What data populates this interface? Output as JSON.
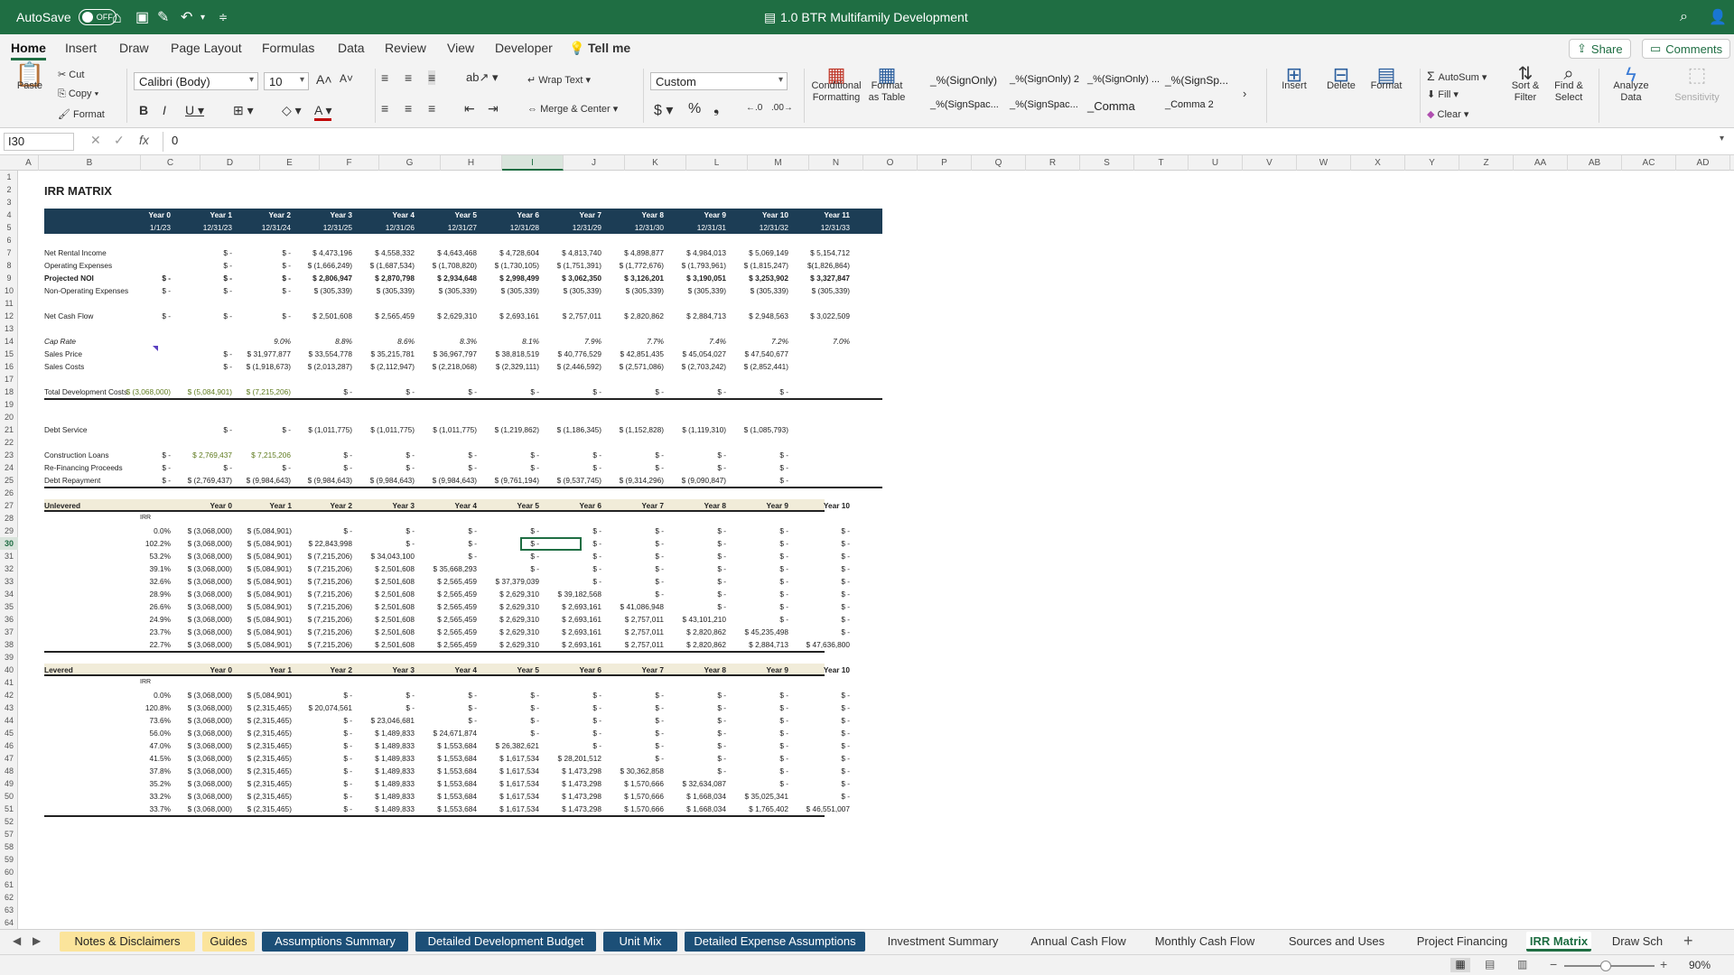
{
  "titlebar": {
    "autosave": "AutoSave",
    "toggle": "OFF",
    "doc_title": "1.0 BTR Multifamily Development"
  },
  "ribbon_tabs": [
    "Home",
    "Insert",
    "Draw",
    "Page Layout",
    "Formulas",
    "Data",
    "Review",
    "View",
    "Developer",
    "Tell me"
  ],
  "share": "Share",
  "comments": "Comments",
  "ribbon": {
    "paste": "Paste",
    "cut": "Cut",
    "copy": "Copy",
    "format": "Format",
    "font": "Calibri (Body)",
    "size": "10",
    "wrap": "Wrap Text",
    "merge": "Merge & Center",
    "number_format": "Custom",
    "cond": "Conditional Formatting",
    "fmt_table": "Format as Table",
    "styles": [
      "_%(SignOnly)",
      "_%(SignOnly) 2",
      "_%(SignOnly) ...",
      "_%(SignSp...",
      "_%(SignSpac...",
      "_%(SignSpac...",
      "_Comma",
      "_Comma 2"
    ],
    "insert": "Insert",
    "delete": "Delete",
    "format_cells": "Format",
    "autosum": "AutoSum",
    "fill": "Fill",
    "clear": "Clear",
    "sort": "Sort & Filter",
    "find": "Find & Select",
    "analyze": "Analyze Data",
    "sensitivity": "Sensitivity"
  },
  "formula_bar": {
    "cell": "I30",
    "fx": "fx",
    "value": "0"
  },
  "columns": [
    "A",
    "B",
    "C",
    "D",
    "E",
    "F",
    "G",
    "H",
    "I",
    "J",
    "K",
    "L",
    "M",
    "N",
    "O",
    "P",
    "Q",
    "R",
    "S",
    "T",
    "U",
    "V",
    "W",
    "X",
    "Y",
    "Z",
    "AA",
    "AB",
    "AC",
    "AD"
  ],
  "title": "IRR MATRIX",
  "years": [
    "Year 0",
    "Year 1",
    "Year 2",
    "Year 3",
    "Year 4",
    "Year 5",
    "Year 6",
    "Year 7",
    "Year 8",
    "Year 9",
    "Year 10",
    "Year 11"
  ],
  "dates": [
    "1/1/23",
    "12/31/23",
    "12/31/24",
    "12/31/25",
    "12/31/26",
    "12/31/27",
    "12/31/28",
    "12/31/29",
    "12/31/30",
    "12/31/31",
    "12/31/32",
    "12/31/33"
  ],
  "rows": {
    "nri": {
      "label": "Net Rental Income",
      "v": [
        "",
        "$ -",
        "$ -",
        "$ 4,473,196",
        "$ 4,558,332",
        "$ 4,643,468",
        "$ 4,728,604",
        "$ 4,813,740",
        "$ 4,898,877",
        "$ 4,984,013",
        "$ 5,069,149",
        "$ 5,154,712"
      ]
    },
    "opex": {
      "label": "Operating Expenses",
      "v": [
        "",
        "$ -",
        "$ -",
        "$ (1,666,249)",
        "$ (1,687,534)",
        "$ (1,708,820)",
        "$ (1,730,105)",
        "$ (1,751,391)",
        "$ (1,772,676)",
        "$ (1,793,961)",
        "$ (1,815,247)",
        "$(1,826,864)"
      ]
    },
    "noi": {
      "label": "Projected NOI",
      "v": [
        "$ -",
        "$ -",
        "$ -",
        "$ 2,806,947",
        "$ 2,870,798",
        "$ 2,934,648",
        "$ 2,998,499",
        "$ 3,062,350",
        "$ 3,126,201",
        "$ 3,190,051",
        "$ 3,253,902",
        "$ 3,327,847"
      ]
    },
    "nonop": {
      "label": "Non-Operating Expenses",
      "v": [
        "$ -",
        "$ -",
        "$ -",
        "$ (305,339)",
        "$ (305,339)",
        "$ (305,339)",
        "$ (305,339)",
        "$ (305,339)",
        "$ (305,339)",
        "$ (305,339)",
        "$ (305,339)",
        "$ (305,339)"
      ]
    },
    "ncf": {
      "label": "Net Cash Flow",
      "v": [
        "$ -",
        "$ -",
        "$ -",
        "$ 2,501,608",
        "$ 2,565,459",
        "$ 2,629,310",
        "$ 2,693,161",
        "$ 2,757,011",
        "$ 2,820,862",
        "$ 2,884,713",
        "$ 2,948,563",
        "$ 3,022,509"
      ]
    },
    "cap": {
      "label": "Cap Rate",
      "v": [
        "",
        "",
        "9.0%",
        "8.8%",
        "8.6%",
        "8.3%",
        "8.1%",
        "7.9%",
        "7.7%",
        "7.4%",
        "7.2%",
        "7.0%"
      ]
    },
    "sp": {
      "label": "Sales Price",
      "v": [
        "",
        "$ -",
        "$ 31,977,877",
        "$ 33,554,778",
        "$ 35,215,781",
        "$ 36,967,797",
        "$ 38,818,519",
        "$ 40,776,529",
        "$ 42,851,435",
        "$ 45,054,027",
        "$ 47,540,677",
        ""
      ]
    },
    "sc": {
      "label": "Sales Costs",
      "v": [
        "",
        "$ -",
        "$ (1,918,673)",
        "$ (2,013,287)",
        "$ (2,112,947)",
        "$ (2,218,068)",
        "$ (2,329,111)",
        "$ (2,446,592)",
        "$ (2,571,086)",
        "$ (2,703,242)",
        "$ (2,852,441)",
        ""
      ]
    },
    "tdc": {
      "label": "Total Development Costs",
      "v": [
        "$ (3,068,000)",
        "$ (5,084,901)",
        "$ (7,215,206)",
        "$ -",
        "$ -",
        "$ -",
        "$ -",
        "$ -",
        "$ -",
        "$ -",
        "$ -",
        ""
      ]
    },
    "ds": {
      "label": "Debt Service",
      "v": [
        "",
        "$ -",
        "$ -",
        "$ (1,011,775)",
        "$ (1,011,775)",
        "$ (1,011,775)",
        "$ (1,219,862)",
        "$ (1,186,345)",
        "$ (1,152,828)",
        "$ (1,119,310)",
        "$ (1,085,793)",
        ""
      ]
    },
    "cl": {
      "label": "Construction Loans",
      "v": [
        "$ -",
        "$ 2,769,437",
        "$ 7,215,206",
        "$ -",
        "$ -",
        "$ -",
        "$ -",
        "$ -",
        "$ -",
        "$ -",
        "$ -",
        ""
      ]
    },
    "rf": {
      "label": "Re-Financing Proceeds",
      "v": [
        "$ -",
        "$ -",
        "$ -",
        "$ -",
        "$ -",
        "$ -",
        "$ -",
        "$ -",
        "$ -",
        "$ -",
        "$ -",
        ""
      ]
    },
    "dr": {
      "label": "Debt Repayment",
      "v": [
        "$ -",
        "$ (2,769,437)",
        "$ (9,984,643)",
        "$ (9,984,643)",
        "$ (9,984,643)",
        "$ (9,984,643)",
        "$ (9,761,194)",
        "$ (9,537,745)",
        "$ (9,314,296)",
        "$ (9,090,847)",
        "$ -",
        ""
      ]
    }
  },
  "unlevered": {
    "label": "Unlevered",
    "irr": "IRR",
    "rows": [
      [
        "0.0%",
        "$ (3,068,000)",
        "$ (5,084,901)",
        "$ -",
        "$ -",
        "$ -",
        "$ -",
        "$ -",
        "$ -",
        "$ -",
        "$ -",
        "$ -"
      ],
      [
        "102.2%",
        "$ (3,068,000)",
        "$ (5,084,901)",
        "$ 22,843,998",
        "$ -",
        "$ -",
        "$ -",
        "$ -",
        "$ -",
        "$ -",
        "$ -",
        "$ -"
      ],
      [
        "53.2%",
        "$ (3,068,000)",
        "$ (5,084,901)",
        "$ (7,215,206)",
        "$ 34,043,100",
        "$ -",
        "$ -",
        "$ -",
        "$ -",
        "$ -",
        "$ -",
        "$ -"
      ],
      [
        "39.1%",
        "$ (3,068,000)",
        "$ (5,084,901)",
        "$ (7,215,206)",
        "$ 2,501,608",
        "$ 35,668,293",
        "$ -",
        "$ -",
        "$ -",
        "$ -",
        "$ -",
        "$ -"
      ],
      [
        "32.6%",
        "$ (3,068,000)",
        "$ (5,084,901)",
        "$ (7,215,206)",
        "$ 2,501,608",
        "$ 2,565,459",
        "$ 37,379,039",
        "$ -",
        "$ -",
        "$ -",
        "$ -",
        "$ -"
      ],
      [
        "28.9%",
        "$ (3,068,000)",
        "$ (5,084,901)",
        "$ (7,215,206)",
        "$ 2,501,608",
        "$ 2,565,459",
        "$ 2,629,310",
        "$ 39,182,568",
        "$ -",
        "$ -",
        "$ -",
        "$ -"
      ],
      [
        "26.6%",
        "$ (3,068,000)",
        "$ (5,084,901)",
        "$ (7,215,206)",
        "$ 2,501,608",
        "$ 2,565,459",
        "$ 2,629,310",
        "$ 2,693,161",
        "$ 41,086,948",
        "$ -",
        "$ -",
        "$ -"
      ],
      [
        "24.9%",
        "$ (3,068,000)",
        "$ (5,084,901)",
        "$ (7,215,206)",
        "$ 2,501,608",
        "$ 2,565,459",
        "$ 2,629,310",
        "$ 2,693,161",
        "$ 2,757,011",
        "$ 43,101,210",
        "$ -",
        "$ -"
      ],
      [
        "23.7%",
        "$ (3,068,000)",
        "$ (5,084,901)",
        "$ (7,215,206)",
        "$ 2,501,608",
        "$ 2,565,459",
        "$ 2,629,310",
        "$ 2,693,161",
        "$ 2,757,011",
        "$ 2,820,862",
        "$ 45,235,498",
        "$ -"
      ],
      [
        "22.7%",
        "$ (3,068,000)",
        "$ (5,084,901)",
        "$ (7,215,206)",
        "$ 2,501,608",
        "$ 2,565,459",
        "$ 2,629,310",
        "$ 2,693,161",
        "$ 2,757,011",
        "$ 2,820,862",
        "$ 2,884,713",
        "$ 47,636,800"
      ]
    ]
  },
  "levered": {
    "label": "Levered",
    "irr": "IRR",
    "rows": [
      [
        "0.0%",
        "$ (3,068,000)",
        "$ (5,084,901)",
        "$ -",
        "$ -",
        "$ -",
        "$ -",
        "$ -",
        "$ -",
        "$ -",
        "$ -",
        "$ -"
      ],
      [
        "120.8%",
        "$ (3,068,000)",
        "$ (2,315,465)",
        "$ 20,074,561",
        "$ -",
        "$ -",
        "$ -",
        "$ -",
        "$ -",
        "$ -",
        "$ -",
        "$ -"
      ],
      [
        "73.6%",
        "$ (3,068,000)",
        "$ (2,315,465)",
        "$ -",
        "$ 23,046,681",
        "$ -",
        "$ -",
        "$ -",
        "$ -",
        "$ -",
        "$ -",
        "$ -"
      ],
      [
        "56.0%",
        "$ (3,068,000)",
        "$ (2,315,465)",
        "$ -",
        "$ 1,489,833",
        "$ 24,671,874",
        "$ -",
        "$ -",
        "$ -",
        "$ -",
        "$ -",
        "$ -"
      ],
      [
        "47.0%",
        "$ (3,068,000)",
        "$ (2,315,465)",
        "$ -",
        "$ 1,489,833",
        "$ 1,553,684",
        "$ 26,382,621",
        "$ -",
        "$ -",
        "$ -",
        "$ -",
        "$ -"
      ],
      [
        "41.5%",
        "$ (3,068,000)",
        "$ (2,315,465)",
        "$ -",
        "$ 1,489,833",
        "$ 1,553,684",
        "$ 1,617,534",
        "$ 28,201,512",
        "$ -",
        "$ -",
        "$ -",
        "$ -"
      ],
      [
        "37.8%",
        "$ (3,068,000)",
        "$ (2,315,465)",
        "$ -",
        "$ 1,489,833",
        "$ 1,553,684",
        "$ 1,617,534",
        "$ 1,473,298",
        "$ 30,362,858",
        "$ -",
        "$ -",
        "$ -"
      ],
      [
        "35.2%",
        "$ (3,068,000)",
        "$ (2,315,465)",
        "$ -",
        "$ 1,489,833",
        "$ 1,553,684",
        "$ 1,617,534",
        "$ 1,473,298",
        "$ 1,570,666",
        "$ 32,634,087",
        "$ -",
        "$ -"
      ],
      [
        "33.2%",
        "$ (3,068,000)",
        "$ (2,315,465)",
        "$ -",
        "$ 1,489,833",
        "$ 1,553,684",
        "$ 1,617,534",
        "$ 1,473,298",
        "$ 1,570,666",
        "$ 1,668,034",
        "$ 35,025,341",
        "$ -"
      ],
      [
        "33.7%",
        "$ (3,068,000)",
        "$ (2,315,465)",
        "$ -",
        "$ 1,489,833",
        "$ 1,553,684",
        "$ 1,617,534",
        "$ 1,473,298",
        "$ 1,570,666",
        "$ 1,668,034",
        "$ 1,765,402",
        "$ 46,551,007"
      ]
    ]
  },
  "sheet_tabs": [
    {
      "label": "Notes & Disclaimers",
      "style": "yellow"
    },
    {
      "label": "Guides",
      "style": "yellow"
    },
    {
      "label": "Assumptions Summary",
      "style": "blue"
    },
    {
      "label": "Detailed Development Budget",
      "style": "blue"
    },
    {
      "label": "Unit Mix",
      "style": "blue"
    },
    {
      "label": "Detailed Expense Assumptions",
      "style": "blue"
    },
    {
      "label": "Investment Summary",
      "style": "plain"
    },
    {
      "label": "Annual Cash Flow",
      "style": "plain"
    },
    {
      "label": "Monthly Cash Flow",
      "style": "plain"
    },
    {
      "label": "Sources and Uses",
      "style": "plain"
    },
    {
      "label": "Project Financing",
      "style": "plain"
    },
    {
      "label": "IRR Matrix",
      "style": "active"
    },
    {
      "label": "Draw Sch",
      "style": "plain"
    }
  ],
  "status": {
    "zoom": "90%"
  },
  "row_numbers": [
    "1",
    "2",
    "3",
    "4",
    "5",
    "6",
    "7",
    "8",
    "9",
    "10",
    "11",
    "12",
    "13",
    "14",
    "15",
    "16",
    "17",
    "18",
    "19",
    "20",
    "21",
    "22",
    "23",
    "24",
    "25",
    "26",
    "27",
    "28",
    "29",
    "30",
    "31",
    "32",
    "33",
    "34",
    "35",
    "36",
    "37",
    "38",
    "39",
    "40",
    "41",
    "42",
    "43",
    "44",
    "45",
    "46",
    "47",
    "48",
    "49",
    "50",
    "51",
    "52",
    "57",
    "58",
    "59",
    "60",
    "61",
    "62",
    "63",
    "64"
  ]
}
